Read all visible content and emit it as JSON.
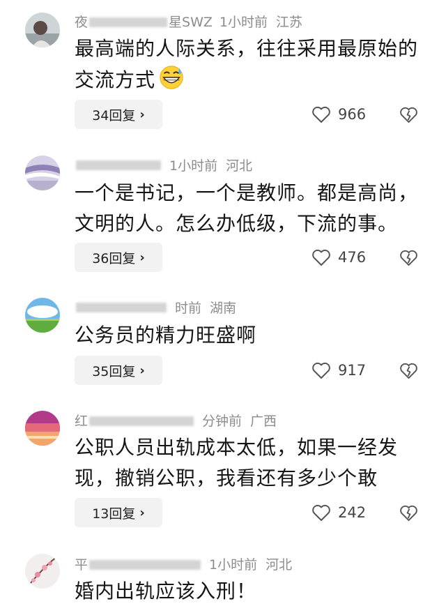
{
  "comments": [
    {
      "name": "夜",
      "name_tail": "星SWZ",
      "time": "1小时前",
      "region": "江苏",
      "text_lines": [
        "最高端的人际关系，往往采用最原始的",
        "交流方式"
      ],
      "emoji": "grinning-sweat-emoji",
      "replies": "34回复",
      "likes": "966"
    },
    {
      "name": "",
      "name_tail": "",
      "time": "1小时前",
      "region": "河北",
      "text_lines": [
        "一个是书记，一个是教师。都是高尚，",
        "文明的人。怎么办低级，下流的事。"
      ],
      "replies": "36回复",
      "likes": "476"
    },
    {
      "name": "",
      "name_tail": "",
      "time": "时前",
      "region": "湖南",
      "text_lines": [
        "公务员的精力旺盛啊"
      ],
      "replies": "35回复",
      "likes": "917"
    },
    {
      "name": "红",
      "name_tail": "",
      "time": "分钟前",
      "region": "广西",
      "text_lines": [
        "公职人员出轨成本太低，如果一经发",
        "现，撤销公职，我看还有多少个敢"
      ],
      "replies": "13回复",
      "likes": "242"
    },
    {
      "name": "平",
      "name_tail": "",
      "time": "1小时前",
      "region": "河北",
      "text_lines": [
        "婚内出轨应该入刑！"
      ],
      "replies": "",
      "likes": ""
    }
  ],
  "icons": {
    "like": "heart-icon",
    "dislike": "broken-heart-icon",
    "reply_chevron": "chevron-right-icon"
  },
  "colors": {
    "meta_text": "#8c8c8c",
    "reply_bg": "#f2f2f2"
  }
}
